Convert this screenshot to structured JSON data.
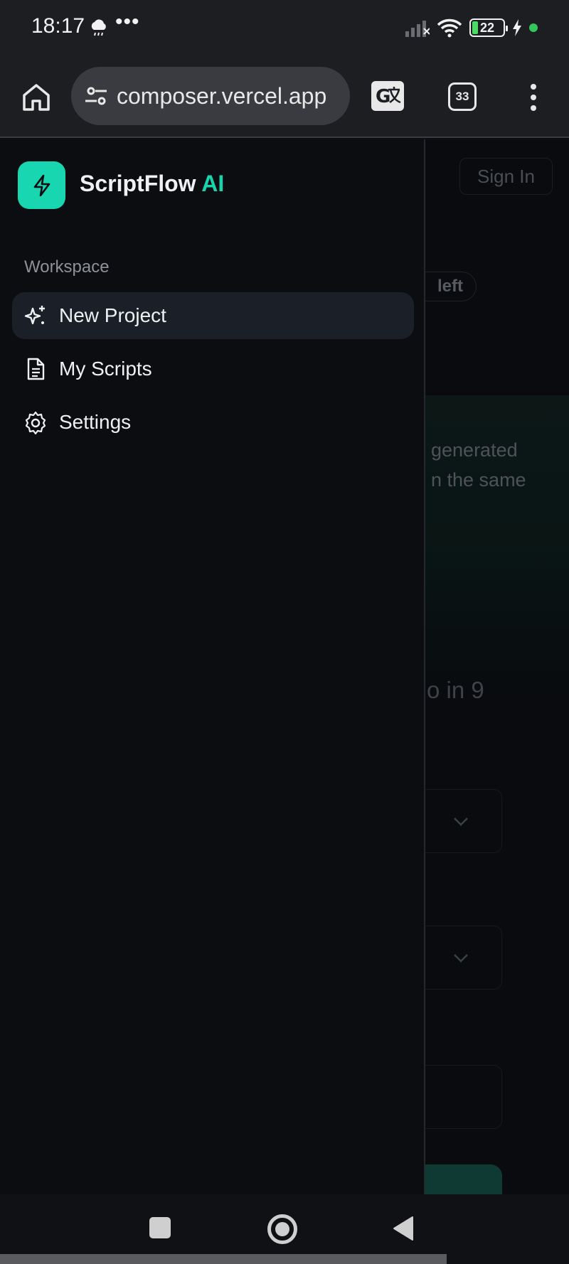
{
  "status_bar": {
    "time": "18:17",
    "overflow_dots": "•••",
    "battery_level": "22",
    "weather_icon": "cloud-rain-icon",
    "indicator_color": "#34c759"
  },
  "browser": {
    "url": "composer.vercel.app",
    "tab_count": "33",
    "icons": [
      "home-icon",
      "site-settings-icon",
      "translate-icon",
      "tabs-icon",
      "more-vertical-icon"
    ]
  },
  "drawer": {
    "brand_name": "ScriptFlow",
    "brand_suffix": "AI",
    "accent_color": "#18d6b0",
    "section_label": "Workspace",
    "items": [
      {
        "label": "New Project",
        "icon": "sparkles-icon",
        "active": true
      },
      {
        "label": "My Scripts",
        "icon": "document-icon",
        "active": false
      },
      {
        "label": "Settings",
        "icon": "gear-icon",
        "active": false
      }
    ]
  },
  "background_page": {
    "sign_in": "Sign In",
    "badge_fragment": "left",
    "desc_line_1": "generated",
    "desc_line_2": "n the same",
    "heading_fragment": "o in 9"
  }
}
